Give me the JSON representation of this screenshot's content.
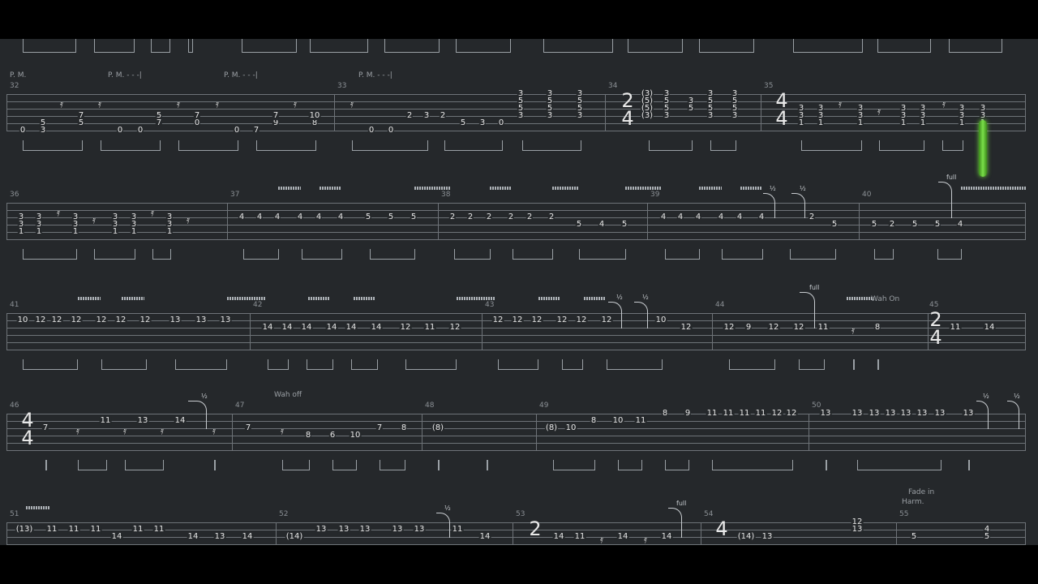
{
  "player": {
    "cursor_measure": 35
  },
  "systems": [
    {
      "id": "sys1",
      "palm_mute": [
        "P. M.",
        "P. M. - - -|",
        "P. M. - - -|",
        "P. M. - - -|"
      ],
      "measures": [
        "32",
        "33",
        "34",
        "35"
      ],
      "timesig_34": {
        "top": "2",
        "bottom": "4"
      },
      "timesig_35": {
        "top": "4",
        "bottom": "4"
      },
      "notes": [
        [
          "0",
          "5",
          "3",
          "7",
          "5",
          "0",
          "0",
          "5",
          "7",
          "7",
          "0",
          "0",
          "7",
          "9",
          "7",
          "8",
          "10"
        ],
        [
          "0",
          "0",
          "2",
          "3",
          "2",
          "5",
          "3",
          "0"
        ],
        [
          "3",
          "5",
          "5",
          "3",
          "3",
          "5",
          "5",
          "3",
          "3",
          "5",
          "5",
          "3",
          "(3)",
          "(5)",
          "(5)",
          "(3)",
          "3",
          "5",
          "5",
          "3",
          "3",
          "5",
          "3",
          "5",
          "5",
          "3",
          "3",
          "5",
          "5",
          "3"
        ],
        [
          "3",
          "3",
          "1",
          "3",
          "3",
          "1",
          "3",
          "3",
          "1",
          "3",
          "3",
          "1",
          "3",
          "3",
          "1",
          "3",
          "3",
          "1",
          "3",
          "3",
          "1"
        ]
      ]
    },
    {
      "id": "sys2",
      "measures": [
        "36",
        "37",
        "38",
        "39",
        "40"
      ],
      "annotations": {
        "bend_half_1": "½",
        "bend_half_2": "½",
        "bend_full": "full"
      },
      "notes": [
        [
          "3",
          "3",
          "1",
          "3",
          "3",
          "1",
          "3",
          "3",
          "1",
          "3",
          "3",
          "1",
          "3",
          "3",
          "1",
          "3",
          "3",
          "1"
        ],
        [
          "4",
          "4",
          "4",
          "4",
          "4",
          "4",
          "5",
          "5",
          "5"
        ],
        [
          "2",
          "2",
          "2",
          "2",
          "2",
          "2",
          "5",
          "4",
          "5"
        ],
        [
          "4",
          "4",
          "4",
          "4",
          "4",
          "4",
          "2",
          "5"
        ],
        [
          "5",
          "2",
          "5",
          "5",
          "4"
        ]
      ]
    },
    {
      "id": "sys3",
      "measures": [
        "41",
        "42",
        "43",
        "44",
        "45"
      ],
      "annotations": {
        "bend_half_1": "½",
        "bend_half_2": "½",
        "bend_full": "full",
        "wah_on": "Wah On"
      },
      "timesig_45": {
        "top": "2",
        "bottom": "4"
      },
      "notes": [
        [
          "10",
          "12",
          "12",
          "12",
          "12",
          "12",
          "12",
          "13",
          "13",
          "13"
        ],
        [
          "14",
          "14",
          "14",
          "14",
          "14",
          "14",
          "12",
          "11",
          "12"
        ],
        [
          "12",
          "12",
          "12",
          "12",
          "12",
          "12",
          "10",
          "12"
        ],
        [
          "12",
          "9",
          "12",
          "12",
          "11",
          "8"
        ],
        [
          "11",
          "14"
        ]
      ]
    },
    {
      "id": "sys4",
      "measures": [
        "46",
        "47",
        "48",
        "49",
        "50"
      ],
      "annotations": {
        "bend_half_1": "½",
        "wah_off": "Wah off",
        "bend_half_2": "½",
        "bend_half_3": "½"
      },
      "timesig_46": {
        "top": "4",
        "bottom": "4"
      },
      "notes": [
        [
          "7",
          "11",
          "13",
          "14"
        ],
        [
          "7",
          "8",
          "6",
          "10",
          "7",
          "8"
        ],
        [
          "(8)"
        ],
        [
          "(8)",
          "10",
          "8",
          "10",
          "11",
          "8",
          "9",
          "11",
          "11",
          "11",
          "11",
          "12",
          "12"
        ],
        [
          "13",
          "13",
          "13",
          "13",
          "13",
          "13",
          "13",
          "13"
        ]
      ]
    },
    {
      "id": "sys5",
      "measures": [
        "51",
        "52",
        "53",
        "54",
        "55"
      ],
      "annotations": {
        "bend_half": "½",
        "bend_full": "full",
        "fade_in": "Fade in",
        "harm": "Harm."
      },
      "timesig_53": {
        "top": "2",
        "bottom": ""
      },
      "timesig_54": {
        "top": "4",
        "bottom": ""
      },
      "notes": [
        [
          "(13)",
          "11",
          "11",
          "11",
          "14",
          "11",
          "11",
          "14",
          "13",
          "14"
        ],
        [
          "(14)",
          "13",
          "13",
          "13",
          "13",
          "13",
          "11",
          "14"
        ],
        [
          "14",
          "11",
          "14",
          "14"
        ],
        [
          "(14)",
          "13",
          "12",
          "13"
        ],
        [
          "5",
          "4",
          "5"
        ]
      ]
    }
  ]
}
